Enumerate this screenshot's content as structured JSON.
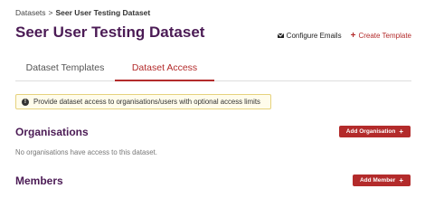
{
  "breadcrumb": {
    "root": "Datasets",
    "separator": ">",
    "current": "Seer User Testing Dataset"
  },
  "header": {
    "title": "Seer User Testing Dataset",
    "configure_emails": "Configure Emails",
    "create_template": "Create Template"
  },
  "tabs": [
    {
      "label": "Dataset Templates",
      "active": false
    },
    {
      "label": "Dataset Access",
      "active": true
    }
  ],
  "info_banner": {
    "text": "Provide dataset access to organisations/users with optional access limits"
  },
  "organisations": {
    "title": "Organisations",
    "add_button": "Add Organisation",
    "empty_text": "No organisations have access to this dataset."
  },
  "members": {
    "title": "Members",
    "add_button": "Add Member"
  },
  "colors": {
    "title": "#4b1b55",
    "accent": "#b32b2b",
    "banner_bg": "#fffceb",
    "banner_border": "#e6d27d"
  },
  "icons": {
    "configure_emails": "envelope-icon",
    "create_template": "plus-icon",
    "info_banner": "info-icon",
    "add_buttons": "plus-icon"
  }
}
